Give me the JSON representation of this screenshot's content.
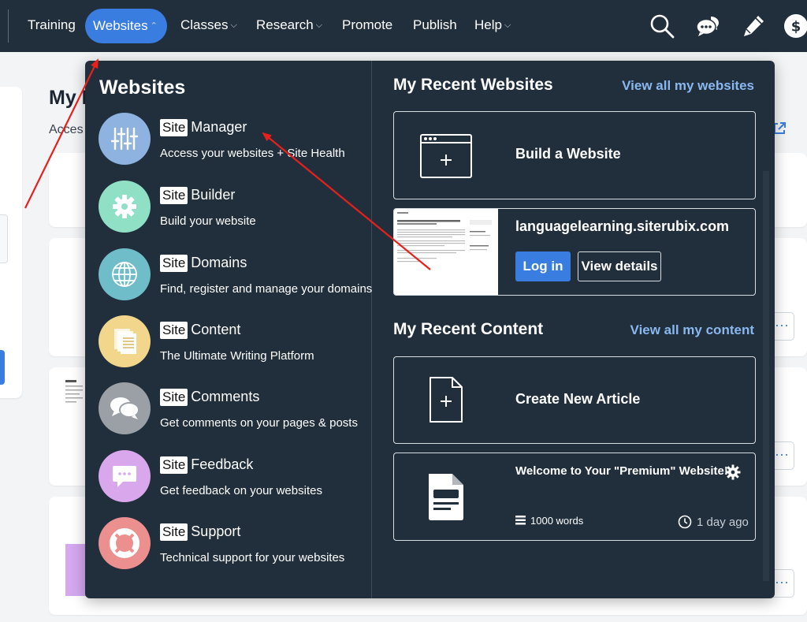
{
  "nav": {
    "items": [
      {
        "label": "Training",
        "chevron": false
      },
      {
        "label": "Websites",
        "chevron": true,
        "active": true
      },
      {
        "label": "Classes",
        "chevron": true
      },
      {
        "label": "Research",
        "chevron": true
      },
      {
        "label": "Promote",
        "chevron": false
      },
      {
        "label": "Publish",
        "chevron": false
      },
      {
        "label": "Help",
        "chevron": true
      }
    ],
    "chevron_down": "⌵",
    "chevron_up": "⌃",
    "icons": [
      "search-icon",
      "chat-icon",
      "pencil-icon",
      "dollar-icon"
    ]
  },
  "background": {
    "title": "My I",
    "subtitle": "Acces",
    "more_glyph": "···"
  },
  "menu": {
    "heading": "Websites",
    "site_badge": "Site",
    "tools": [
      {
        "name": "Manager",
        "desc": "Access your websites + Site Health",
        "color": "#8fb3e0",
        "icon": "sliders-icon"
      },
      {
        "name": "Builder",
        "desc": "Build your website",
        "color": "#8fe0c4",
        "icon": "gear-icon"
      },
      {
        "name": "Domains",
        "desc": "Find, register and manage your domains",
        "color": "#6fbdc9",
        "icon": "globe-icon"
      },
      {
        "name": "Content",
        "desc": "The Ultimate Writing Platform",
        "color": "#f2d68c",
        "icon": "documents-icon"
      },
      {
        "name": "Comments",
        "desc": "Get comments on your pages & posts",
        "color": "#9aa0a6",
        "icon": "speech-bubbles-icon"
      },
      {
        "name": "Feedback",
        "desc": "Get feedback on your websites",
        "color": "#d9a8ec",
        "icon": "feedback-bubble-icon"
      },
      {
        "name": "Support",
        "desc": "Technical support for your websites",
        "color": "#ec8f8f",
        "icon": "lifebuoy-icon"
      }
    ],
    "recent_websites": {
      "title": "My Recent Websites",
      "view_all": "View all my websites",
      "build_label": "Build a Website",
      "site_domain": "languagelearning.siterubix.com",
      "login_label": "Log in",
      "details_label": "View details"
    },
    "recent_content": {
      "title": "My Recent Content",
      "view_all": "View all my content",
      "create_label": "Create New Article",
      "article_title": "Welcome to Your \"Premium\" Website!",
      "word_count": "1000 words",
      "time_ago": "1 day ago"
    }
  },
  "colors": {
    "nav_bg": "#212f3c",
    "accent": "#3a7de0",
    "link": "#8ab8ee",
    "annotation_arrow": "#e8201c"
  }
}
